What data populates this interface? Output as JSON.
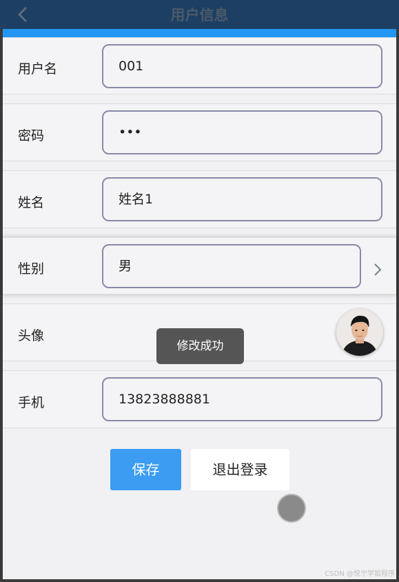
{
  "header": {
    "title": "用户信息",
    "back_icon": "chevron-left-icon"
  },
  "colors": {
    "navbar": "#1d3f63",
    "accent_strip": "#2196f3",
    "save_button": "#3c9cf2",
    "field_border": "#8989a8"
  },
  "form": {
    "username": {
      "label": "用户名",
      "value": "001"
    },
    "password": {
      "label": "密码",
      "value": "•••"
    },
    "name": {
      "label": "姓名",
      "value": "姓名1"
    },
    "gender": {
      "label": "性别",
      "value": "男",
      "icon": "chevron-right-icon"
    },
    "avatar": {
      "label": "头像",
      "icon": "avatar-photo"
    },
    "phone": {
      "label": "手机",
      "value": "13823888881"
    }
  },
  "toast": {
    "text": "修改成功"
  },
  "buttons": {
    "save": "保存",
    "logout": "退出登录"
  },
  "watermark": "CSDN @悦宁学姐程序"
}
